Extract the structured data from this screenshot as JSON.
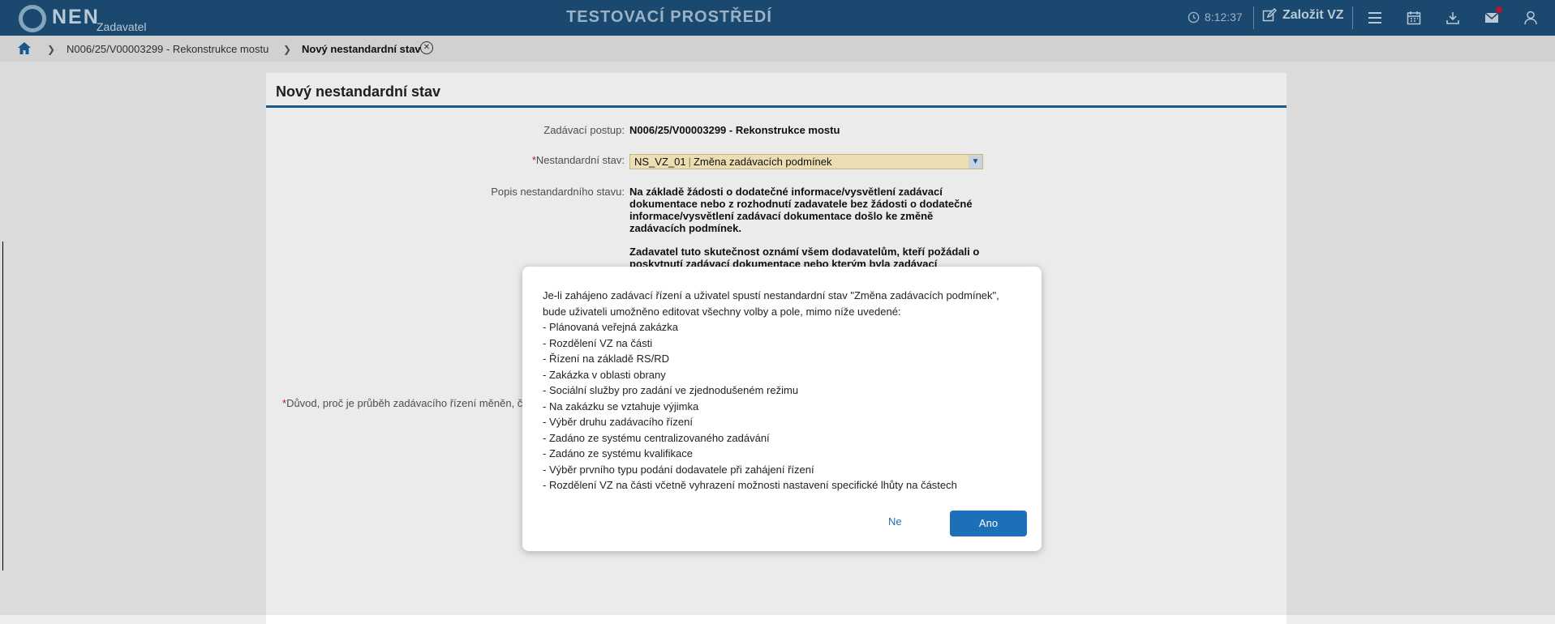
{
  "app": {
    "logo_text": "NEN",
    "logo_sub": "Zadavatel",
    "environment_title": "TESTOVACÍ PROSTŘEDÍ",
    "clock": "8:12:37",
    "create_label": "Založit VZ"
  },
  "breadcrumb": {
    "items": [
      {
        "label": "N006/25/V00003299 - Rekonstrukce mostu"
      },
      {
        "label": "Nový nestandardní stav"
      }
    ]
  },
  "form": {
    "title": "Nový nestandardní stav",
    "procedure_label": "Zadávací postup:",
    "procedure_value": "N006/25/V00003299 - Rekonstrukce mostu",
    "state_label": "Nestandardní stav:",
    "state_code": "NS_VZ_01",
    "state_name": "Změna zadávacích podmínek",
    "description_label": "Popis nestandardního stavu:",
    "description_p1": "Na základě žádosti o dodatečné informace/vysvětlení zadávací dokumentace nebo z rozhodnutí zadavatele bez žádosti o dodatečné informace/vysvětlení zadávací dokumentace došlo ke změně zadávacích podmínek.",
    "description_p2": "Zadavatel tuto skutečnost oznámí všem dodavatelům, kteří požádali o poskytnutí zadávací dokumentace nebo kterým byla zadávací",
    "reason_label": "Důvod, proč je průběh zadávacího řízení měněn, či p"
  },
  "dialog": {
    "intro": "Je-li zahájeno zadávací řízení a uživatel spustí nestandardní stav \"Změna zadávacích podmínek\", bude uživateli umožněno editovat všechny volby a pole, mimo níže uvedené:",
    "items": [
      "- Plánovaná veřejná zakázka",
      "- Rozdělení VZ na části",
      "- Řízení na základě RS/RD",
      "- Zakázka v oblasti obrany",
      "- Sociální služby pro zadání ve zjednodušeném režimu",
      "- Na zakázku se vztahuje výjimka",
      "- Výběr druhu zadávacího řízení",
      "- Zadáno ze systému centralizovaného zadávání",
      "- Zadáno ze systému kvalifikace",
      "- Výběr prvního typu podání dodavatele při zahájení řízení",
      "- Rozdělení VZ na části včetně vyhrazení možnosti nastavení specifické lhůty na částech"
    ],
    "no_label": "Ne",
    "yes_label": "Ano"
  },
  "icons": {
    "logo": "nen-logo-ring",
    "clock": "clock-icon",
    "create": "edit-icon",
    "menu": "hamburger-menu-icon",
    "calendar": "calendar-icon",
    "download": "download-icon",
    "mail": "mail-icon",
    "user": "user-icon",
    "home": "home-icon",
    "close": "close-circle-icon"
  },
  "colors": {
    "topbar": "#1d4f78",
    "accent": "#1d6fb8",
    "required": "#c0183a",
    "select_bg": "#fff1c2"
  }
}
